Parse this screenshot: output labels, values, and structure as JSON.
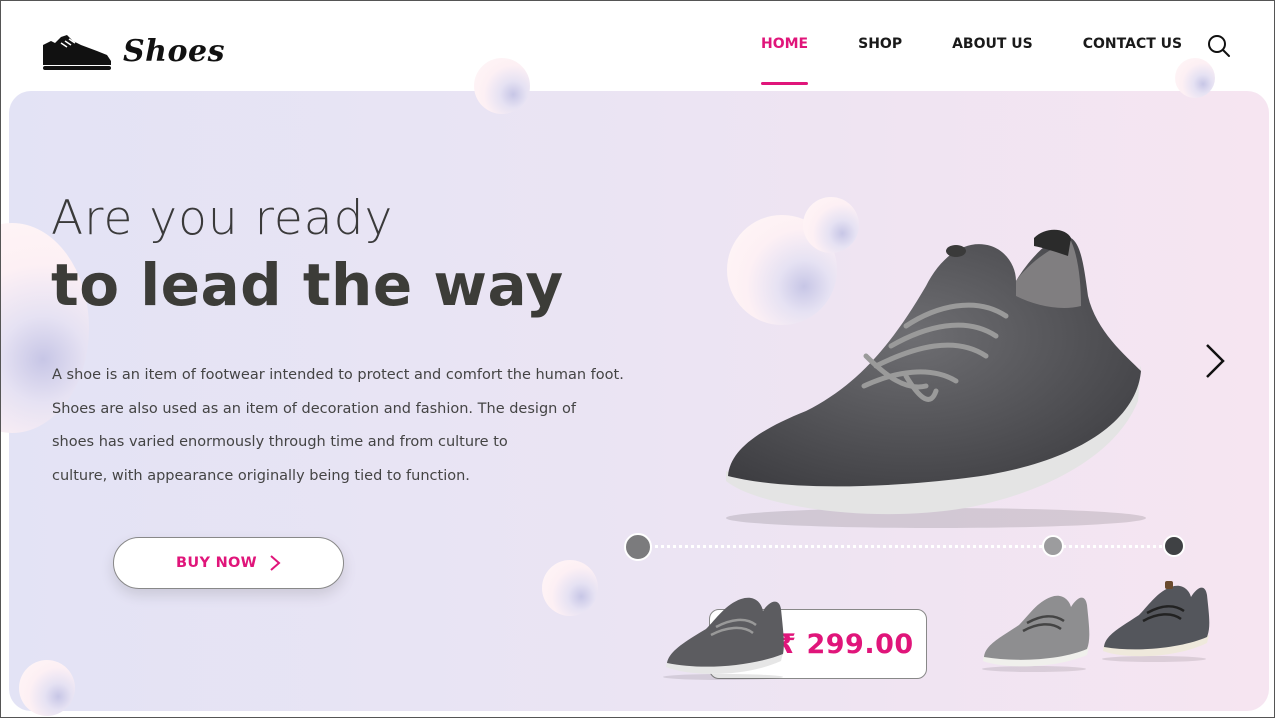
{
  "brand": {
    "name": "Shoes",
    "logo_icon": "sneaker-icon"
  },
  "nav": {
    "items": [
      {
        "label": "HOME",
        "active": true
      },
      {
        "label": "SHOP",
        "active": false
      },
      {
        "label": "ABOUT US",
        "active": false
      },
      {
        "label": "CONTACT US",
        "active": false
      }
    ],
    "search_icon": "search-icon"
  },
  "hero": {
    "headline_light": "Are you ready",
    "headline_bold": "to lead the way",
    "description_lines": [
      "A shoe is an item of footwear intended to protect and comfort the human foot.",
      "Shoes are also used as an item of decoration and fashion. The design of",
      "shoes has varied enormously through time and from culture to",
      "culture, with appearance originally being tied to function."
    ],
    "cta_label": "BUY NOW",
    "cta_icon": "chevron-right-icon",
    "next_icon": "chevron-right-icon"
  },
  "product": {
    "price": "₹ 299.00",
    "slides": 3,
    "active_slide": 1
  },
  "colors": {
    "accent": "#e0157a",
    "text_dark": "#3c3c38",
    "shoe_gray": "#5a5a5e",
    "sole": "#e6e6e6"
  }
}
